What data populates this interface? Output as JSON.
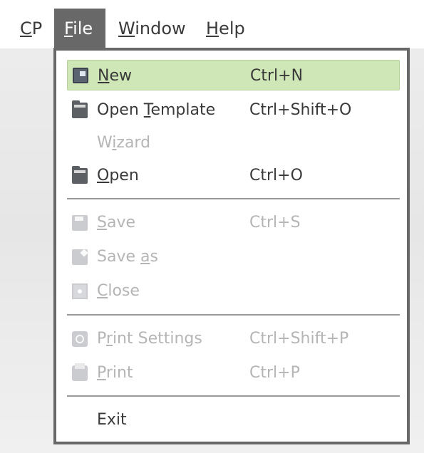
{
  "menubar": {
    "items": [
      {
        "label": "CP",
        "mnemonic": "C",
        "rest": "P"
      },
      {
        "label": "File",
        "mnemonic": "F",
        "rest": "ile"
      },
      {
        "label": "Window",
        "mnemonic": "W",
        "rest": "indow"
      },
      {
        "label": "Help",
        "mnemonic": "H",
        "rest": "elp"
      }
    ],
    "active": "File"
  },
  "file_menu": {
    "items": [
      {
        "label": "New",
        "pre": "",
        "mn": "N",
        "post": "ew",
        "shortcut": "Ctrl+N",
        "enabled": true,
        "highlighted": true,
        "icon": "new-document-icon"
      },
      {
        "label": "Open Template",
        "pre": "Open ",
        "mn": "T",
        "post": "emplate",
        "shortcut": "Ctrl+Shift+O",
        "enabled": true,
        "icon": "open-template-icon"
      },
      {
        "label": "Wizard",
        "pre": "W",
        "mn": "i",
        "post": "zard",
        "shortcut": "",
        "enabled": false,
        "icon": ""
      },
      {
        "label": "Open",
        "pre": "",
        "mn": "O",
        "post": "pen",
        "shortcut": "Ctrl+O",
        "enabled": true,
        "icon": "open-folder-icon"
      },
      {
        "label": "Save",
        "pre": "",
        "mn": "S",
        "post": "ave",
        "shortcut": "Ctrl+S",
        "enabled": false,
        "icon": "save-icon"
      },
      {
        "label": "Save as",
        "pre": "Save ",
        "mn": "a",
        "post": "s",
        "shortcut": "",
        "enabled": false,
        "icon": "save-as-icon"
      },
      {
        "label": "Close",
        "pre": "",
        "mn": "C",
        "post": "lose",
        "shortcut": "",
        "enabled": false,
        "icon": "close-document-icon"
      },
      {
        "label": "Print Settings",
        "pre": "P",
        "mn": "r",
        "post": "int Settings",
        "shortcut": "Ctrl+Shift+P",
        "enabled": false,
        "icon": "print-settings-icon"
      },
      {
        "label": "Print",
        "pre": "",
        "mn": "P",
        "post": "rint",
        "shortcut": "Ctrl+P",
        "enabled": false,
        "icon": "printer-icon"
      },
      {
        "label": "Exit",
        "pre": "Exit",
        "mn": "",
        "post": "",
        "shortcut": "",
        "enabled": true,
        "icon": ""
      }
    ]
  },
  "colors": {
    "highlight": "#cfe6b6",
    "active_menu": "#686868",
    "disabled_text": "#b5b5b5"
  }
}
